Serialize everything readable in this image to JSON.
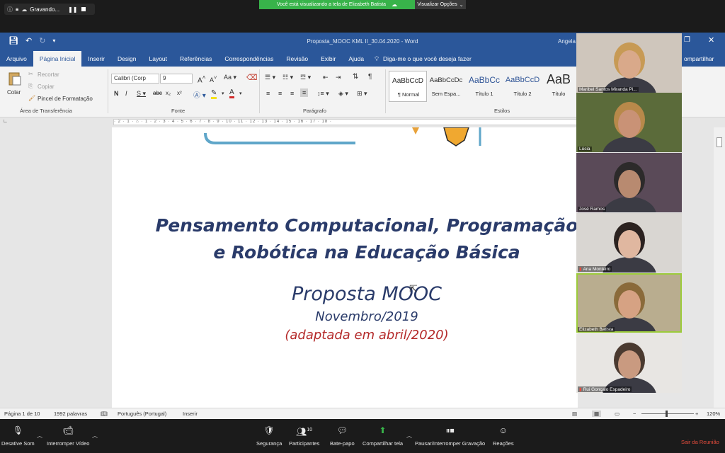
{
  "zoom_top": {
    "recording_label": "Gravando...",
    "share_banner": "Você está visualizando a tela de Elizabeth Batista",
    "view_options": "Visualizar Opções"
  },
  "word": {
    "title": "Proposta_MOOC KML II_30.04.2020  -  Word",
    "user": "Angela",
    "tabs": [
      "Arquivo",
      "Página Inicial",
      "Inserir",
      "Design",
      "Layout",
      "Referências",
      "Correspondências",
      "Revisão",
      "Exibir",
      "Ajuda"
    ],
    "tell_me": "Diga-me o que você deseja fazer",
    "share": "ompartilhar",
    "ribbon": {
      "paste": "Colar",
      "cut": "Recortar",
      "copy": "Copiar",
      "format_painter": "Pincel de Formatação",
      "clipboard_group": "Área de Transferência",
      "font_name": "Calibri (Corp",
      "font_size": "9",
      "font_group": "Fonte",
      "paragraph_group": "Parágrafo",
      "styles_group": "Estilos",
      "styles": [
        {
          "preview": "AaBbCcD",
          "name": "¶ Normal"
        },
        {
          "preview": "AaBbCcDc",
          "name": "Sem Espa..."
        },
        {
          "preview": "AaBbCc",
          "name": "Título 1"
        },
        {
          "preview": "AaBbCcD",
          "name": "Título 2"
        },
        {
          "preview": "AaB",
          "name": "Título"
        }
      ]
    },
    "ruler_ticks": "· 2 · 1 · ⌂ · 1 · 2 · 3 · 4 · 5 · 6 · 7 · 8 · 9 · 10 · 11 · 12 · 13 · 14 · 15 · 16 · 17 · 18 ·",
    "document": {
      "title_line1": "Pensamento Computacional, Programação",
      "title_line2": "e Robótica na Educação Básica",
      "subtitle": "Proposta MOOC",
      "date": "Novembro/2019",
      "adapted": "(adaptada em abril/2020)"
    },
    "status": {
      "page": "Página 1 de 10",
      "words": "1992 palavras",
      "language": "Português (Portugal)",
      "mode": "Inserir",
      "zoom": "120%"
    }
  },
  "participants": [
    {
      "name": "Maribel Santos Miranda Pi...",
      "muted": false,
      "speaking": false,
      "bg": "#cfc6bc",
      "skin": "#d9a98a",
      "hair": "#c79a55"
    },
    {
      "name": "Lúcia",
      "muted": false,
      "speaking": false,
      "bg": "#5b6b3a",
      "skin": "#c99276",
      "hair": "#b8894a"
    },
    {
      "name": "José Ramos",
      "muted": false,
      "speaking": false,
      "bg": "#5a4a58",
      "skin": "#b88a70",
      "hair": "#2c2a2a"
    },
    {
      "name": "Ana Monteiro",
      "muted": true,
      "speaking": false,
      "bg": "#d9d6d2",
      "skin": "#e0b7a0",
      "hair": "#2b2220"
    },
    {
      "name": "Elizabeth Batista",
      "muted": false,
      "speaking": true,
      "bg": "#b9ad8f",
      "skin": "#d6a283",
      "hair": "#8a6a3a"
    },
    {
      "name": "Rui Gonçalo Espadeiro",
      "muted": true,
      "speaking": false,
      "bg": "#e8e6e3",
      "skin": "#c99a80",
      "hair": "#4a3a30"
    }
  ],
  "zoom_bottom": {
    "mute": "Desative Som",
    "video": "Interromper Vídeo",
    "security": "Segurança",
    "participants": "Participantes",
    "participants_count": "10",
    "chat": "Bate-papo",
    "share": "Compartilhar tela",
    "recording": "Pausar/Interromper Gravação",
    "reactions": "Reações",
    "leave": "Sair da Reunião"
  },
  "colors": {
    "word_blue": "#2b579a",
    "zoom_green": "#38b34a",
    "doc_title": "#2a3b6a",
    "doc_red": "#b42a2a",
    "leave_red": "#e74c3c"
  }
}
